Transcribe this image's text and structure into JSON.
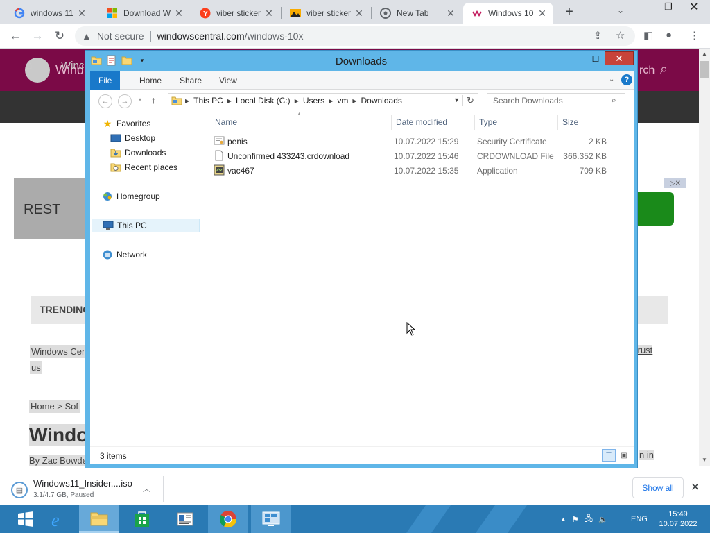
{
  "browser": {
    "tabs": [
      {
        "title": "windows 11",
        "favicon": "google-icon"
      },
      {
        "title": "Download W",
        "favicon": "microsoft-icon"
      },
      {
        "title": "viber sticker",
        "favicon": "yandex-icon"
      },
      {
        "title": "viber sticker",
        "favicon": "image-icon"
      },
      {
        "title": "New Tab",
        "favicon": "chrome-icon"
      },
      {
        "title": "Windows 10",
        "favicon": "windowscentral-icon",
        "active": true
      }
    ],
    "security": "Not secure",
    "url_host": "windowscentral.com",
    "url_path": "/windows-10x"
  },
  "webpage": {
    "brand": "Wind",
    "search": "rch",
    "nav_item": "Winc",
    "promo": "REST",
    "trending": "TRENDING",
    "disclaimer": "Windows Cen",
    "disclaimer2": "us",
    "trust": "trust",
    "breadcrumb": "Home  >  Sof",
    "title": "Windo",
    "author": "By Zac Bowde",
    "right_text": "n in"
  },
  "explorer": {
    "title": "Downloads",
    "ribbon_tabs": [
      "File",
      "Home",
      "Share",
      "View"
    ],
    "breadcrumbs": [
      "This PC",
      "Local Disk (C:)",
      "Users",
      "vm",
      "Downloads"
    ],
    "search_placeholder": "Search Downloads",
    "nav": {
      "favorites": "Favorites",
      "desktop": "Desktop",
      "downloads": "Downloads",
      "recent": "Recent places",
      "homegroup": "Homegroup",
      "thispc": "This PC",
      "network": "Network"
    },
    "columns": [
      "Name",
      "Date modified",
      "Type",
      "Size"
    ],
    "files": [
      {
        "name": "penis",
        "date": "10.07.2022 15:29",
        "type": "Security Certificate",
        "size": "2 KB",
        "icon": "certificate-icon"
      },
      {
        "name": "Unconfirmed 433243.crdownload",
        "date": "10.07.2022 15:46",
        "type": "CRDOWNLOAD File",
        "size": "366.352 KB",
        "icon": "file-icon"
      },
      {
        "name": "vac467",
        "date": "10.07.2022 15:35",
        "type": "Application",
        "size": "709 KB",
        "icon": "application-icon"
      }
    ],
    "status": "3 items"
  },
  "download": {
    "name": "Windows11_Insider....iso",
    "status": "3.1/4.7 GB, Paused",
    "show_all": "Show all"
  },
  "taskbar": {
    "lang": "ENG",
    "time": "15:49",
    "date": "10.07.2022"
  },
  "colors": {
    "window_frame": "#5fb6e8",
    "ribbon_file": "#1979ca",
    "taskbar": "#2a7ab4",
    "wc_header": "#7b0a47"
  }
}
